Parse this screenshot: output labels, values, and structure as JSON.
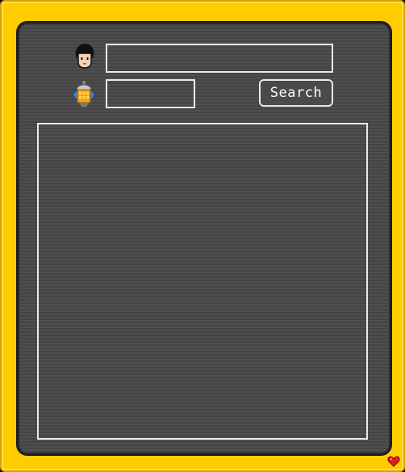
{
  "search": {
    "name_value": "",
    "room_value": "",
    "button_label": "Search"
  },
  "results": {
    "items": []
  },
  "icons": {
    "user": "user-head-icon",
    "room": "room-robot-icon",
    "favorite": "heart-icon"
  },
  "colors": {
    "frame": "#ffcc00",
    "panel": "#4a4a4a",
    "border": "#e9e9e9",
    "heart": "#e02020"
  }
}
